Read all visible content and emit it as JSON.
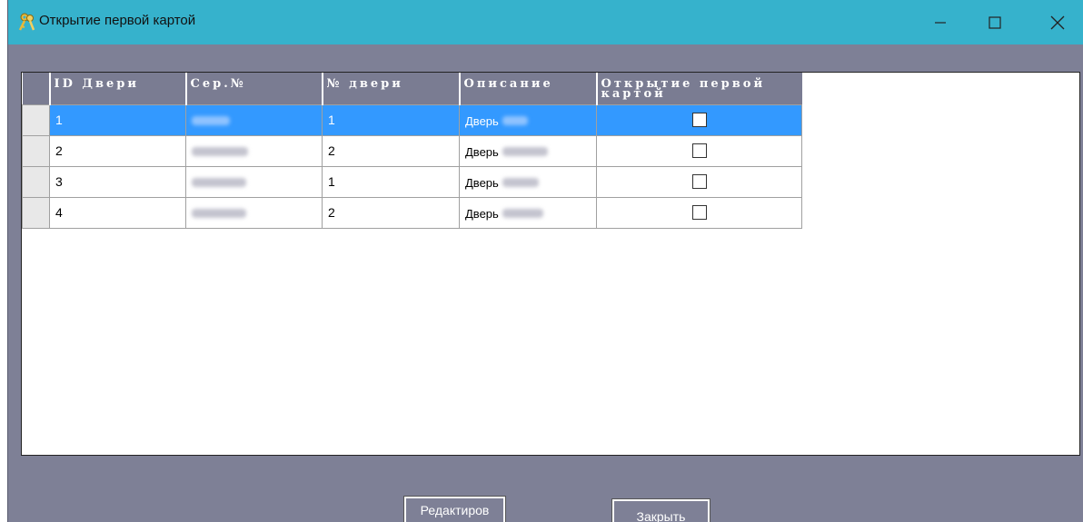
{
  "window": {
    "title": "Открытие первой картой",
    "icon": "keys-icon",
    "minimize_glyph": "minimize",
    "maximize_glyph": "maximize",
    "close_glyph": "close"
  },
  "grid": {
    "columns": [
      "ID Двери",
      "Сер.№",
      "№ двери",
      "Описание",
      "Открытие первой картой"
    ],
    "rows": [
      {
        "id": "1",
        "serial": "",
        "door_no": "1",
        "description": "Дверь",
        "first_card_open": false,
        "selected": true
      },
      {
        "id": "2",
        "serial": "",
        "door_no": "2",
        "description": "Дверь",
        "first_card_open": false,
        "selected": false
      },
      {
        "id": "3",
        "serial": "",
        "door_no": "1",
        "description": "Дверь",
        "first_card_open": false,
        "selected": false
      },
      {
        "id": "4",
        "serial": "",
        "door_no": "2",
        "description": "Дверь",
        "first_card_open": false,
        "selected": false
      }
    ]
  },
  "buttons": {
    "edit_label": "Редактиров",
    "close_label": "Закрыть"
  },
  "colors": {
    "titlebar": "#36b2cc",
    "window_bg": "#7e8096",
    "header_bg": "#7a7c92",
    "selection": "#3399ff"
  }
}
